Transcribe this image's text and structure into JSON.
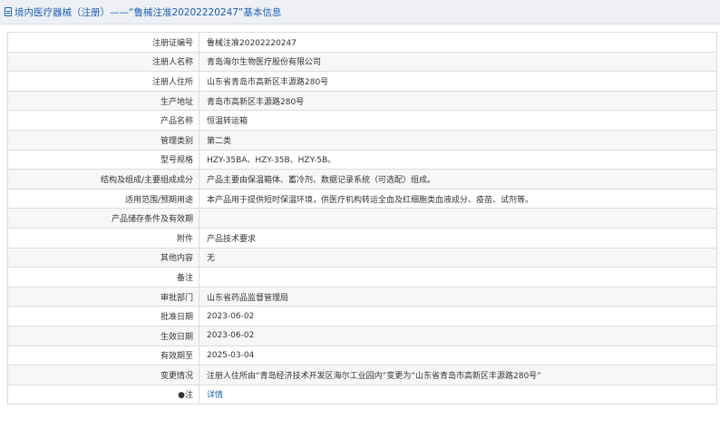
{
  "header": {
    "title": "境内医疗器械（注册）——“鲁械注准20202220247”基本信息"
  },
  "rows": [
    {
      "label": "注册证编号",
      "value": "鲁械注准20202220247"
    },
    {
      "label": "注册人名称",
      "value": "青岛海尔生物医疗股份有限公司"
    },
    {
      "label": "注册人住所",
      "value": "山东省青岛市高新区丰源路280号"
    },
    {
      "label": "生产地址",
      "value": "青岛市高新区丰源路280号"
    },
    {
      "label": "产品名称",
      "value": "恒温转运箱"
    },
    {
      "label": "管理类别",
      "value": "第二类"
    },
    {
      "label": "型号规格",
      "value": "HZY-35BA、HZY-35B、HZY-5B。"
    },
    {
      "label": "结构及组成/主要组成成分",
      "value": "产品主要由保温箱体、蓄冷剂、数据记录系统（可选配）组成。"
    },
    {
      "label": "适用范围/预期用途",
      "value": "本产品用于提供短时保温环境，供医疗机构转运全血及红细胞类血液成分、疫苗、试剂等。"
    },
    {
      "label": "产品储存条件及有效期",
      "value": ""
    },
    {
      "label": "附件",
      "value": "产品技术要求"
    },
    {
      "label": "其他内容",
      "value": "无"
    },
    {
      "label": "备注",
      "value": ""
    },
    {
      "label": "审批部门",
      "value": "山东省药品监督管理局"
    },
    {
      "label": "批准日期",
      "value": "2023-06-02"
    },
    {
      "label": "生效日期",
      "value": "2023-06-02"
    },
    {
      "label": "有效期至",
      "value": "2025-03-04"
    },
    {
      "label": "变更情况",
      "value": "注册人住所由“青岛经济技术开发区海尔工业园内”变更为“山东省青岛市高新区丰源路280号”"
    }
  ],
  "note_row": {
    "mark": "●",
    "label": "注",
    "link": "详情"
  },
  "colors": {
    "accent": "#1a5fb4",
    "header_bg": "#eef0f5",
    "border": "#dcdcdc"
  }
}
